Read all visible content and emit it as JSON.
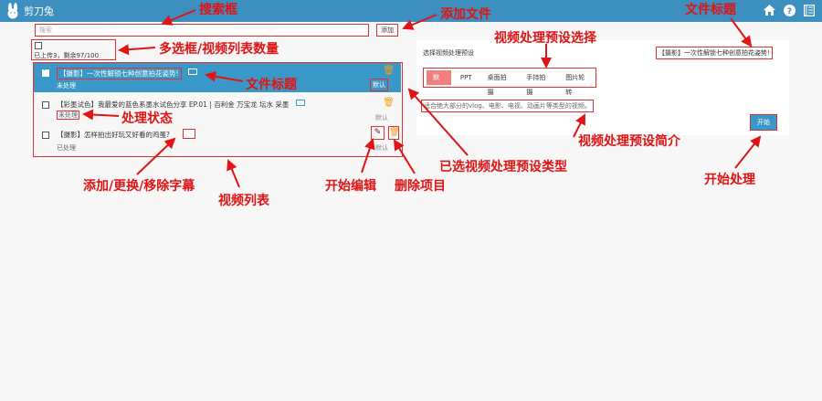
{
  "app": {
    "title": "剪刀兔"
  },
  "search": {
    "placeholder": "搜索"
  },
  "toolbar": {
    "add_label": "添加"
  },
  "list_meta": {
    "count_text": "已上传3，剩余97/100"
  },
  "videos": [
    {
      "title": "【摄影】一次性解锁七种创意拍花姿势!",
      "status": "未处理",
      "preset": "默认",
      "selected": true
    },
    {
      "title": "【彩墨试色】我最爱的蓝色系墨水试色分享 EP.01 | 百利金 万宝龙 坛水 采墨",
      "status": "未处理",
      "preset": "默认",
      "selected": false
    },
    {
      "title": "【摄影】怎样拍出好玩又好看的鸡蛋?",
      "status": "已处理",
      "preset": "默认",
      "selected": false
    }
  ],
  "panel": {
    "title": "选择视频处理预设",
    "file_title": "【摄影】一次性解锁七种创意拍花姿势!",
    "presets": [
      "默认",
      "PPT",
      "桌面拍摄",
      "手持拍摄",
      "图片轮转"
    ],
    "active_preset": "默认",
    "description": "适合绝大部分的vlog、电影、电视、动画片等类型的视频。",
    "start_label": "开始"
  },
  "annotations": {
    "search_box": "搜索框",
    "add_file": "添加文件",
    "file_title_top": "文件标题",
    "preset_select": "视频处理预设选择",
    "multi_select": "多选框/视频列表数量",
    "file_title_row": "文件标题",
    "process_status": "处理状态",
    "preset_desc": "视频处理预设简介",
    "selected_preset_type": "已选视频处理预设类型",
    "subtitle": "添加/更换/移除字幕",
    "start_edit": "开始编辑",
    "delete_item": "删除项目",
    "video_list": "视频列表",
    "start_process": "开始处理"
  },
  "colors": {
    "header": "#3d8fc0",
    "selected_row": "#3a98c9",
    "annotation": "#e01414",
    "active_preset": "#f08080"
  }
}
